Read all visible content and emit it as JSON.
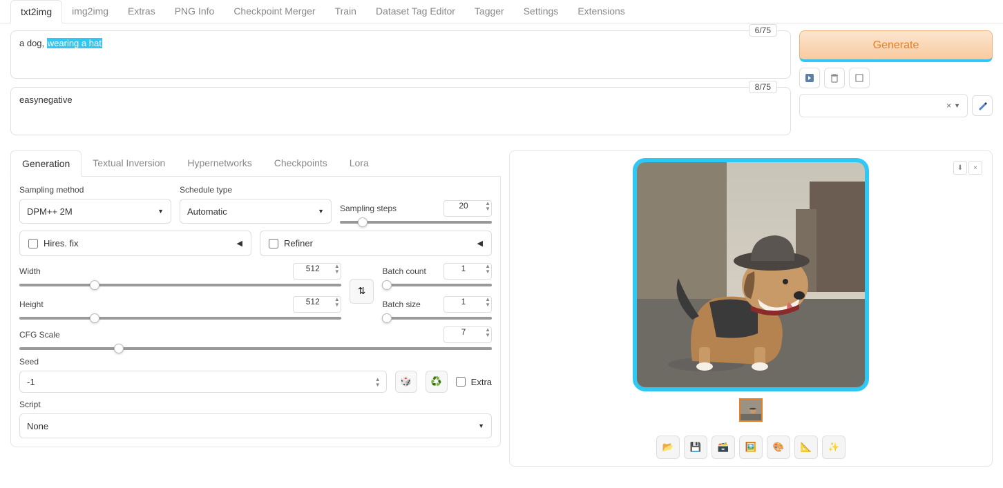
{
  "tabs": [
    "txt2img",
    "img2img",
    "Extras",
    "PNG Info",
    "Checkpoint Merger",
    "Train",
    "Dataset Tag Editor",
    "Tagger",
    "Settings",
    "Extensions"
  ],
  "prompt": {
    "text_plain": "a dog, ",
    "text_hl": "wearing a hat",
    "tokens": "6/75"
  },
  "neg_prompt": {
    "text": "easynegative",
    "tokens": "8/75"
  },
  "generate_label": "Generate",
  "style_close": "×",
  "sub_tabs": [
    "Generation",
    "Textual Inversion",
    "Hypernetworks",
    "Checkpoints",
    "Lora"
  ],
  "sampling_method": {
    "label": "Sampling method",
    "value": "DPM++ 2M"
  },
  "schedule": {
    "label": "Schedule type",
    "value": "Automatic"
  },
  "steps": {
    "label": "Sampling steps",
    "value": "20"
  },
  "hires": {
    "label": "Hires. fix"
  },
  "refiner": {
    "label": "Refiner"
  },
  "width": {
    "label": "Width",
    "value": "512"
  },
  "height": {
    "label": "Height",
    "value": "512"
  },
  "batch_count": {
    "label": "Batch count",
    "value": "1"
  },
  "batch_size": {
    "label": "Batch size",
    "value": "1"
  },
  "cfg": {
    "label": "CFG Scale",
    "value": "7"
  },
  "seed": {
    "label": "Seed",
    "value": "-1"
  },
  "extra": "Extra",
  "script": {
    "label": "Script",
    "value": "None"
  }
}
